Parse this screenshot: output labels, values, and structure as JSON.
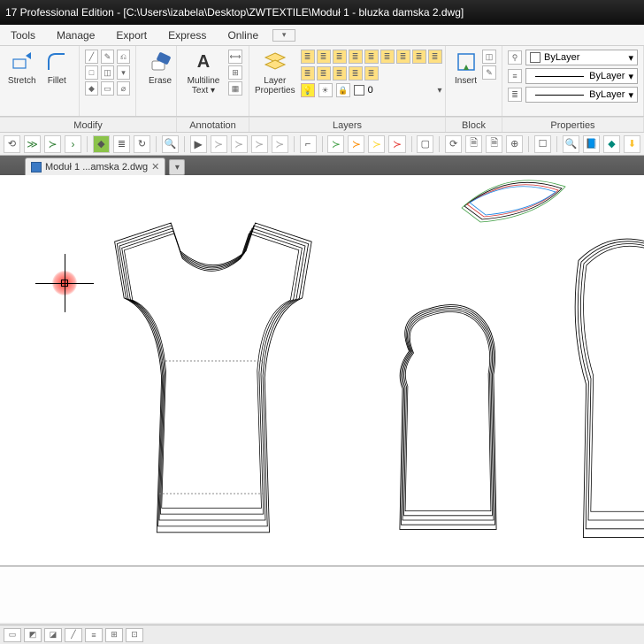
{
  "title": "17 Professional Edition - [C:\\Users\\izabela\\Desktop\\ZWTEXTILE\\Moduł 1 - bluzka damska 2.dwg]",
  "menu": {
    "tools": "Tools",
    "manage": "Manage",
    "export": "Export",
    "express": "Express",
    "online": "Online"
  },
  "ribbon": {
    "stretch": "Stretch",
    "fillet": "Fillet",
    "erase": "Erase",
    "mtext": "Multiline\nText ▾",
    "layerprops": "Layer\nProperties",
    "insert": "Insert"
  },
  "groups": {
    "modify": "Modify",
    "annotation": "Annotation",
    "layers": "Layers",
    "block": "Block",
    "properties": "Properties"
  },
  "properties": {
    "color_label": "ByLayer",
    "lw_label": "ByLayer",
    "lt_label": "ByLayer"
  },
  "tab": {
    "label": "Moduł 1 ...amska 2.dwg"
  },
  "icons": {
    "stretch": "↗",
    "fillet": "◠",
    "erase": "◧",
    "mtext": "A",
    "layer": "≣",
    "insert": "▣",
    "colors": [
      "#d32f2f",
      "#fbc02d",
      "#43a047",
      "#00acc1",
      "#1e88e5",
      "#8e24aa",
      "#ffffff",
      "#212121"
    ]
  },
  "caret": "▾"
}
